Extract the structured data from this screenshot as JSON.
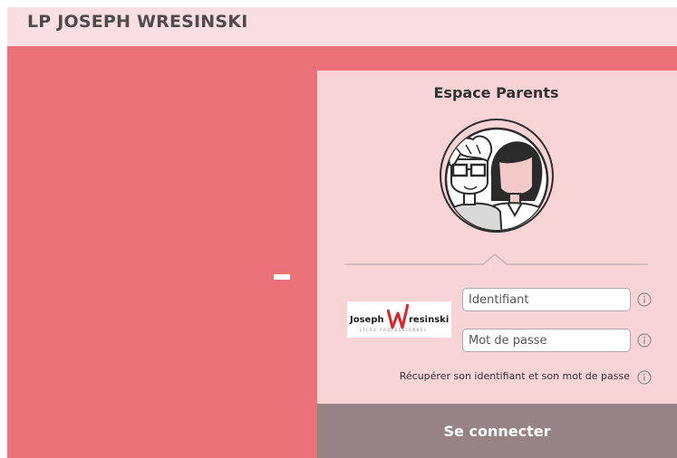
{
  "header": {
    "school_name": "LP JOSEPH WRESINSKI"
  },
  "login_panel": {
    "title": "Espace Parents",
    "avatar_icon": "parents-avatar-icon",
    "school_logo": {
      "word_joseph": "Joseph",
      "word_rest": "resinski",
      "subtitle": "LYCÉE PROFESSIONNEL",
      "accent_color": "#d8262c"
    },
    "login_field": {
      "placeholder": "Identifiant",
      "value": ""
    },
    "password_field": {
      "placeholder": "Mot de passe",
      "value": ""
    },
    "recover_link": "Récupérer son identifiant et son mot de passe",
    "submit_label": "Se connecter"
  },
  "colors": {
    "background": "#eb7179",
    "header_background": "#f9dfe1",
    "panel_background": "#f8d4d6",
    "submit_background": "#978383"
  }
}
